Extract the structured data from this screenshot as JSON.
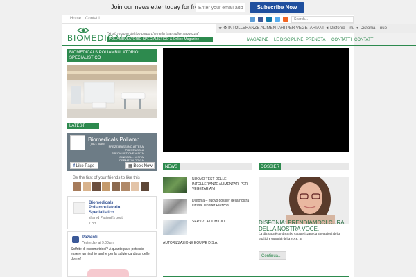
{
  "newsletter": {
    "text": "Join our newsletter today for free.",
    "placeholder": "Enter your email address",
    "button": "Subscribe Now",
    "button_color": "#1f4f9e"
  },
  "topbar": {
    "links": [
      "Home",
      "Contatti"
    ],
    "social_icons": [
      "email-icon",
      "facebook-icon",
      "linkedin-icon",
      "twitter-icon",
      "rss-icon"
    ],
    "search_placeholder": "Search..."
  },
  "logo": {
    "word": "BIOMEDICALS",
    "tagline": "\"A più regione del tuo corpo che nella tua miglior saggezza\"",
    "subtitle": "POLIAMBULATORIO SPECIALISTICO & Online Magazine"
  },
  "ticker": {
    "text": "★ ♻ INTOLLERANZE ALIMENTARI PER VEGETARIANI   ◄ Disfonia – nuo",
    "ext": "◄ Disfonia – nuo"
  },
  "nav": {
    "items": [
      "MAGAZINE",
      "LE DISCIPLINE",
      "PRENOTA",
      "CONTATTI"
    ],
    "ext": "CONTATTI"
  },
  "left": {
    "header1": "BIOMEDICALS POLIAMBULATORIO SPECIALISTICO",
    "header2": "LATEST NEWS",
    "fb": {
      "title": "Biomedicals Poliamb...",
      "sub": "1,063 likes",
      "promo": "PREZZI BASSI NO ATTESA PRESTAZIONI SPECIALISTICHE VISITA GINECOL... VISITA DERMATOLOGICA",
      "like": "Like Page",
      "book": "Book Now"
    },
    "friends_text": "Be the first of your friends to like this",
    "post1": {
      "name": "Biomedicals Poliambulatorio Specialistico",
      "action": "shared Pazienti's post.",
      "time": "7 hrs"
    },
    "post2": {
      "name": "Pazienti",
      "time": "Yesterday at 9:00am",
      "body": "Soffrite di endometriosi? A quanto pare potreste essere un rischio anche per la salute cardiaca delle donne!"
    }
  },
  "news": {
    "tab": "NEWS",
    "items": [
      {
        "text": "NUOVO TEST DELLE INTOLLERANZE ALIMENTARI PER VEGETARIANI"
      },
      {
        "text": "Disfonia – nuovo dossier della nostra Dr.ssa Jennifer Piazzoni"
      },
      {
        "text": "SERVIZI A DOMICILIO"
      }
    ],
    "plain": "AUTORIZZAZIONE EQUIPE D.S.A."
  },
  "dossier": {
    "tab": "DOSSIER",
    "title": "DISFONIA: PRENDIAMOCI CURA DELLA NOSTRA VOCE.",
    "body": "La disfonia è un disturbo caratterizzato da alterazioni della qualità e quantità della voce, in",
    "button": "Continua..."
  },
  "colors": {
    "accent": "#2d8a4e",
    "facebook": "#3b5998"
  }
}
